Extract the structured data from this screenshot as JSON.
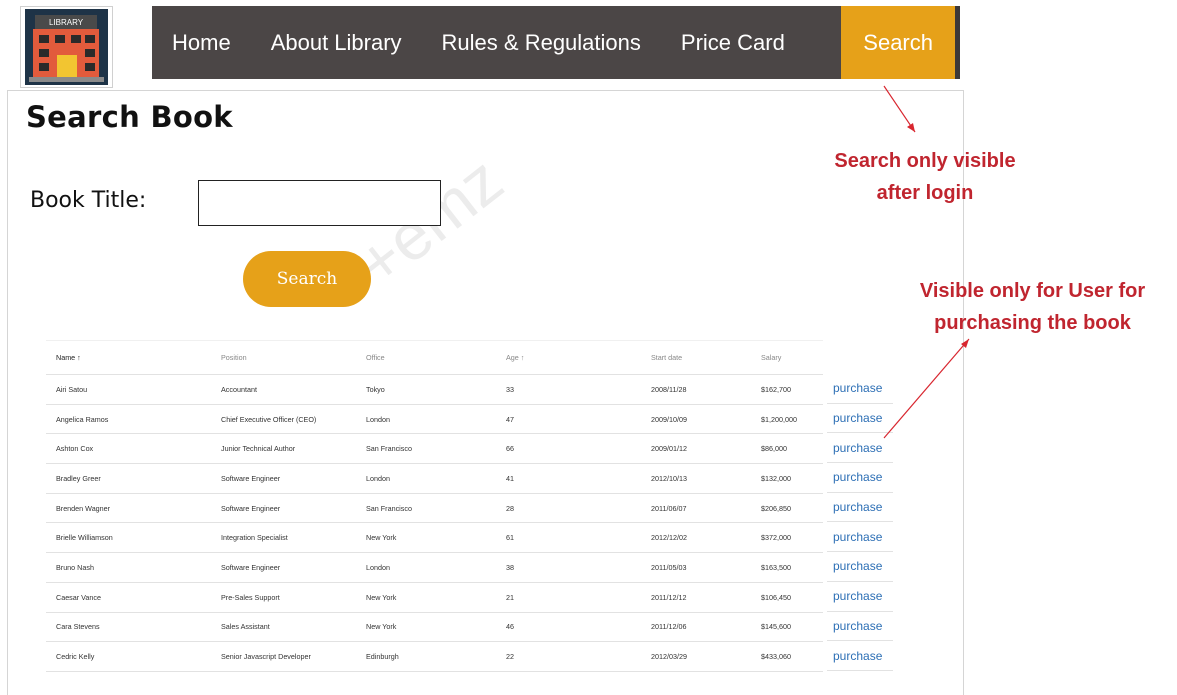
{
  "logo": {
    "text": "LIBRARY"
  },
  "nav": {
    "items": [
      {
        "label": "Home"
      },
      {
        "label": "About Library"
      },
      {
        "label": "Rules & Regulations"
      },
      {
        "label": "Price Card"
      }
    ],
    "active_label": "Search"
  },
  "page": {
    "title": "Search Book",
    "book_title_label": "Book Title:",
    "book_title_value": "",
    "search_button": "Search",
    "watermark": "+emz"
  },
  "table": {
    "headers": [
      "Name ↑",
      "Position",
      "Office",
      "Age ↑",
      "Start date",
      "Salary"
    ],
    "rows": [
      [
        "Airi Satou",
        "Accountant",
        "Tokyo",
        "33",
        "2008/11/28",
        "$162,700"
      ],
      [
        "Angelica Ramos",
        "Chief Executive Officer (CEO)",
        "London",
        "47",
        "2009/10/09",
        "$1,200,000"
      ],
      [
        "Ashton Cox",
        "Junior Technical Author",
        "San Francisco",
        "66",
        "2009/01/12",
        "$86,000"
      ],
      [
        "Bradley Greer",
        "Software Engineer",
        "London",
        "41",
        "2012/10/13",
        "$132,000"
      ],
      [
        "Brenden Wagner",
        "Software Engineer",
        "San Francisco",
        "28",
        "2011/06/07",
        "$206,850"
      ],
      [
        "Brielle Williamson",
        "Integration Specialist",
        "New York",
        "61",
        "2012/12/02",
        "$372,000"
      ],
      [
        "Bruno Nash",
        "Software Engineer",
        "London",
        "38",
        "2011/05/03",
        "$163,500"
      ],
      [
        "Caesar Vance",
        "Pre-Sales Support",
        "New York",
        "21",
        "2011/12/12",
        "$106,450"
      ],
      [
        "Cara Stevens",
        "Sales Assistant",
        "New York",
        "46",
        "2011/12/06",
        "$145,600"
      ],
      [
        "Cedric Kelly",
        "Senior Javascript Developer",
        "Edinburgh",
        "22",
        "2012/03/29",
        "$433,060"
      ]
    ],
    "action_label": "purchase"
  },
  "annotations": {
    "search_note": [
      "Search only visible",
      "after login"
    ],
    "purchase_note": [
      "Visible only for User for",
      "purchasing the book"
    ]
  },
  "colors": {
    "nav_bg": "#4b4646",
    "accent": "#e6a119",
    "annotation": "#c0252f",
    "link": "#2d6fb5"
  }
}
